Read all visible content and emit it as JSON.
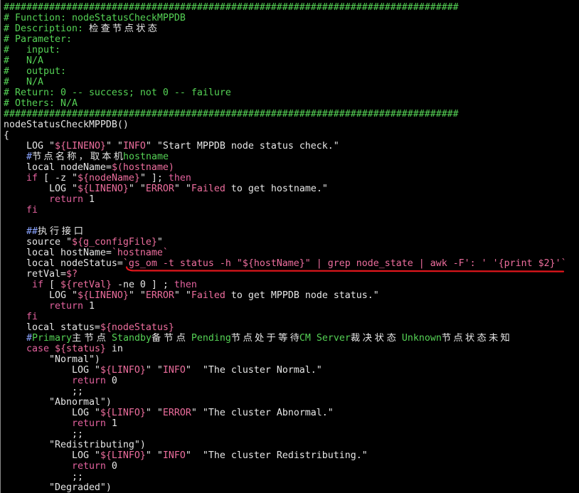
{
  "editor": {
    "palette": {
      "background": "#000000",
      "plain": "#e6e6e6",
      "comment": "#55d255",
      "keyword": "#e3629e",
      "variable": "#ee6e9e",
      "hash": "#8aa4ff",
      "cjk": "#e6e6e6",
      "annotation": "#e3161c",
      "border": "#8a8a8a"
    },
    "lines": [
      [
        [
          "################################################################################",
          "comment"
        ]
      ],
      [
        [
          "# Function: nodeStatusCheckMPPDB",
          "comment"
        ]
      ],
      [
        [
          "# Description: ",
          "comment"
        ],
        [
          "检查节点状态",
          "cjk"
        ]
      ],
      [
        [
          "# Parameter:",
          "comment"
        ]
      ],
      [
        [
          "#   input:",
          "comment"
        ]
      ],
      [
        [
          "#   N/A",
          "comment"
        ]
      ],
      [
        [
          "#   output:",
          "comment"
        ]
      ],
      [
        [
          "#   N/A",
          "comment"
        ]
      ],
      [
        [
          "# Return: 0 -- success; not 0 -- failure",
          "comment"
        ]
      ],
      [
        [
          "# Others: N/A",
          "comment"
        ]
      ],
      [
        [
          "################################################################################",
          "comment"
        ]
      ],
      [
        [
          "nodeStatusCheckMPPDB()",
          "plain"
        ]
      ],
      [
        [
          "{",
          "plain"
        ]
      ],
      [
        [
          "    LOG \"",
          "plain"
        ],
        [
          "${LINENO}",
          "variable"
        ],
        [
          "\" \"",
          "plain"
        ],
        [
          "INFO",
          "variable"
        ],
        [
          "\" \"Start MPPDB node status check.\"",
          "plain"
        ]
      ],
      [
        [
          "    ",
          "plain"
        ],
        [
          "#",
          "hash"
        ],
        [
          "节点名称，取本机",
          "cjk"
        ],
        [
          "hostname",
          "comment"
        ]
      ],
      [
        [
          "    local nodeName=",
          "plain"
        ],
        [
          "$(hostname)",
          "variable"
        ]
      ],
      [
        [
          "    ",
          "plain"
        ],
        [
          "if",
          "keyword"
        ],
        [
          " [ -z \"",
          "plain"
        ],
        [
          "${nodeName}",
          "variable"
        ],
        [
          "\" ]; ",
          "plain"
        ],
        [
          "then",
          "keyword"
        ]
      ],
      [
        [
          "        LOG \"",
          "plain"
        ],
        [
          "${LINENO}",
          "variable"
        ],
        [
          "\" \"",
          "plain"
        ],
        [
          "ERROR",
          "variable"
        ],
        [
          "\" \"",
          "plain"
        ],
        [
          "Failed",
          "variable"
        ],
        [
          " to get hostname.\"",
          "plain"
        ]
      ],
      [
        [
          "        ",
          "plain"
        ],
        [
          "return",
          "keyword"
        ],
        [
          " 1",
          "plain"
        ]
      ],
      [
        [
          "    ",
          "plain"
        ],
        [
          "fi",
          "keyword"
        ]
      ],
      [],
      [
        [
          "    ",
          "plain"
        ],
        [
          "##",
          "hash"
        ],
        [
          "执行接口",
          "cjk"
        ]
      ],
      [
        [
          "    source \"",
          "plain"
        ],
        [
          "${g_configFile}",
          "variable"
        ],
        [
          "\"",
          "plain"
        ]
      ],
      [
        [
          "    local hostName=",
          "plain"
        ],
        [
          "`hostname`",
          "variable"
        ]
      ],
      [
        [
          "    local nodeStatus=",
          "plain"
        ],
        [
          "`gs_om -t status -h \"${hostName}\" | grep node_state | awk -F': ' '{print $2}'`",
          "variable"
        ]
      ],
      [
        [
          "    retVal=",
          "plain"
        ],
        [
          "$?",
          "variable"
        ]
      ],
      [
        [
          "     ",
          "plain"
        ],
        [
          "if",
          "keyword"
        ],
        [
          " [ ",
          "plain"
        ],
        [
          "${retVal}",
          "variable"
        ],
        [
          " -ne 0 ] ; ",
          "plain"
        ],
        [
          "then",
          "keyword"
        ]
      ],
      [
        [
          "        LOG \"",
          "plain"
        ],
        [
          "${LINENO}",
          "variable"
        ],
        [
          "\" \"",
          "plain"
        ],
        [
          "ERROR",
          "variable"
        ],
        [
          "\" \"",
          "plain"
        ],
        [
          "Failed",
          "variable"
        ],
        [
          " to get MPPDB node status.\"",
          "plain"
        ]
      ],
      [
        [
          "        ",
          "plain"
        ],
        [
          "return",
          "keyword"
        ],
        [
          " 1",
          "plain"
        ]
      ],
      [
        [
          "    ",
          "plain"
        ],
        [
          "fi",
          "keyword"
        ]
      ],
      [
        [
          "    local status=",
          "plain"
        ],
        [
          "${nodeStatus}",
          "variable"
        ]
      ],
      [
        [
          "    ",
          "plain"
        ],
        [
          "#",
          "hash"
        ],
        [
          "Primary",
          "comment"
        ],
        [
          "主节点",
          "cjk"
        ],
        [
          " Standby",
          "comment"
        ],
        [
          "备节点",
          "cjk"
        ],
        [
          " Pending",
          "comment"
        ],
        [
          "节点处于等待",
          "cjk"
        ],
        [
          "CM Server",
          "comment"
        ],
        [
          "裁决状态",
          "cjk"
        ],
        [
          " Unknown",
          "comment"
        ],
        [
          "节点状态未知",
          "cjk"
        ]
      ],
      [
        [
          "    ",
          "plain"
        ],
        [
          "case",
          "keyword"
        ],
        [
          " ",
          "plain"
        ],
        [
          "${status}",
          "variable"
        ],
        [
          " in",
          "plain"
        ]
      ],
      [
        [
          "        \"Normal\")",
          "plain"
        ]
      ],
      [
        [
          "            LOG \"",
          "plain"
        ],
        [
          "${LINFO}",
          "variable"
        ],
        [
          "\" \"",
          "plain"
        ],
        [
          "INFO",
          "variable"
        ],
        [
          "\"  \"The cluster Normal.\"",
          "plain"
        ]
      ],
      [
        [
          "            ",
          "plain"
        ],
        [
          "return",
          "keyword"
        ],
        [
          " 0",
          "plain"
        ]
      ],
      [
        [
          "            ;;",
          "plain"
        ]
      ],
      [
        [
          "        \"Abnormal\")",
          "plain"
        ]
      ],
      [
        [
          "            LOG \"",
          "plain"
        ],
        [
          "${LINFO}",
          "variable"
        ],
        [
          "\" \"",
          "plain"
        ],
        [
          "ERROR",
          "variable"
        ],
        [
          "\" \"The cluster Abnormal.\"",
          "plain"
        ]
      ],
      [
        [
          "            ",
          "plain"
        ],
        [
          "return",
          "keyword"
        ],
        [
          " 1",
          "plain"
        ]
      ],
      [
        [
          "            ;;",
          "plain"
        ]
      ],
      [
        [
          "        \"Redistributing\")",
          "plain"
        ]
      ],
      [
        [
          "            LOG \"",
          "plain"
        ],
        [
          "${LINFO}",
          "variable"
        ],
        [
          "\" \"",
          "plain"
        ],
        [
          "INFO",
          "variable"
        ],
        [
          "\"  \"The cluster Redistributing.\"",
          "plain"
        ]
      ],
      [
        [
          "            ",
          "plain"
        ],
        [
          "return",
          "keyword"
        ],
        [
          " 0",
          "plain"
        ]
      ],
      [
        [
          "            ;;",
          "plain"
        ]
      ],
      [
        [
          "        \"Degraded\")",
          "plain"
        ]
      ]
    ]
  }
}
